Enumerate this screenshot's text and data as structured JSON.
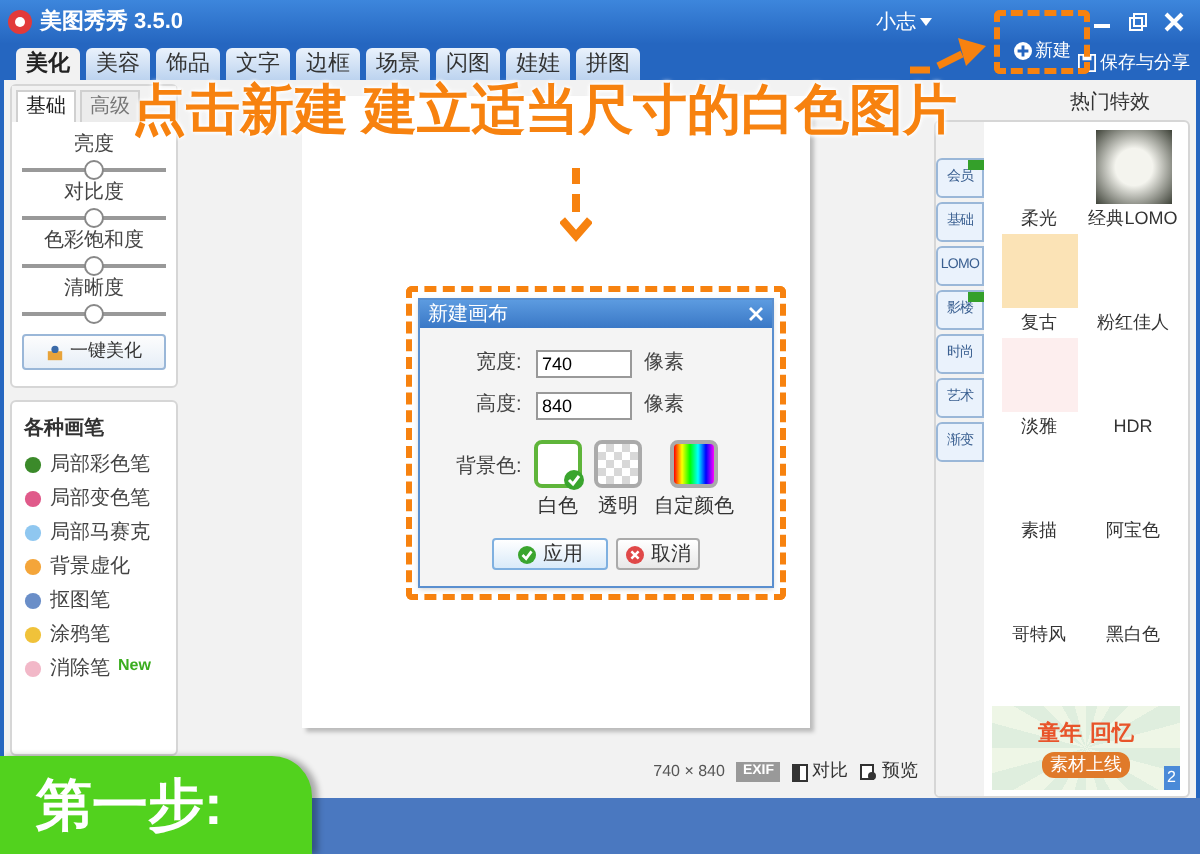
{
  "window": {
    "title": "美图秀秀 3.5.0",
    "user": "小志"
  },
  "tabs": [
    {
      "label": "美化",
      "selected": true
    },
    {
      "label": "美容",
      "selected": false
    },
    {
      "label": "饰品",
      "selected": false
    },
    {
      "label": "文字",
      "selected": false
    },
    {
      "label": "边框",
      "selected": false
    },
    {
      "label": "场景",
      "selected": false
    },
    {
      "label": "闪图",
      "selected": false
    },
    {
      "label": "娃娃",
      "selected": false
    },
    {
      "label": "拼图",
      "selected": false
    }
  ],
  "toolbar": {
    "new_button": "新建",
    "save_button": "保存与分享"
  },
  "left_panel": {
    "subtabs": [
      {
        "label": "基础",
        "selected": true
      },
      {
        "label": "高级",
        "selected": false
      }
    ],
    "sliders": [
      {
        "label": "亮度",
        "level": 0.5
      },
      {
        "label": "对比度",
        "level": 0.5
      },
      {
        "label": "色彩饱和度",
        "level": 0.5
      },
      {
        "label": "清晰度",
        "level": 0.5
      }
    ],
    "auto_button": "一键美化"
  },
  "brushes": {
    "title": "各种画笔",
    "items": [
      {
        "label": "局部彩色笔"
      },
      {
        "label": "局部变色笔"
      },
      {
        "label": "局部马赛克"
      },
      {
        "label": "背景虚化"
      },
      {
        "label": "抠图笔"
      },
      {
        "label": "涂鸦笔"
      },
      {
        "label": "消除笔",
        "badge": "New"
      }
    ]
  },
  "dialog": {
    "title": "新建画布",
    "fields": [
      {
        "label": "宽度:",
        "value": "740",
        "unit": "像素"
      },
      {
        "label": "高度:",
        "value": "840",
        "unit": "像素"
      }
    ],
    "background_label": "背景色:",
    "options": [
      {
        "label": "白色",
        "kind": "white",
        "selected": true
      },
      {
        "label": "透明",
        "kind": "transparent",
        "selected": false
      },
      {
        "label": "自定颜色",
        "kind": "custom",
        "selected": false
      }
    ],
    "apply_button": "应用",
    "cancel_button": "取消"
  },
  "status_bar": {
    "size": "740 × 840",
    "exif": "EXIF",
    "compare": "对比",
    "preview": "预览"
  },
  "effects": {
    "header": "热门特效",
    "categories": [
      {
        "label": "会员",
        "new": true
      },
      {
        "label": "基础",
        "new": false
      },
      {
        "label": "LOMO",
        "new": false
      },
      {
        "label": "影楼",
        "new": true
      },
      {
        "label": "时尚",
        "new": false
      },
      {
        "label": "艺术",
        "new": false
      },
      {
        "label": "渐变",
        "new": false
      }
    ],
    "items": [
      {
        "label": "柔光",
        "kind": "blank"
      },
      {
        "label": "经典LOMO",
        "kind": "vignette"
      },
      {
        "label": "复古",
        "kind": "beige"
      },
      {
        "label": "粉红佳人",
        "kind": "blank"
      },
      {
        "label": "淡雅",
        "kind": "pink"
      },
      {
        "label": "HDR",
        "kind": "blank"
      },
      {
        "label": "素描",
        "kind": "blank"
      },
      {
        "label": "阿宝色",
        "kind": "blank"
      },
      {
        "label": "哥特风",
        "kind": "blank"
      },
      {
        "label": "黑白色",
        "kind": "blank"
      }
    ]
  },
  "banner": {
    "line_1": "童年",
    "line_2": "回忆",
    "line_3": "素材上线",
    "page": "2"
  },
  "overlay": {
    "instruction": "点击新建 建立适当尺寸的白色图片",
    "step": "第一步:"
  }
}
